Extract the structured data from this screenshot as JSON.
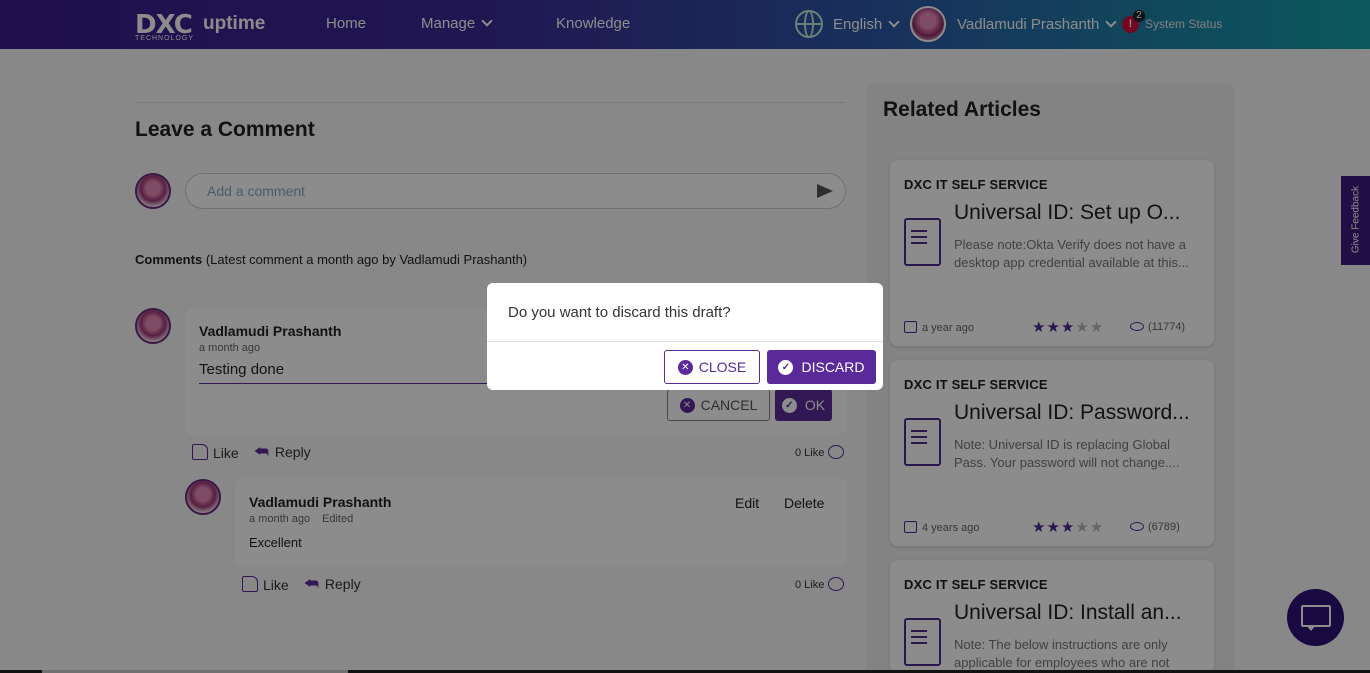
{
  "header": {
    "logo_dxc": "DXC",
    "logo_sub": "TECHNOLOGY",
    "logo_app": "uptime",
    "nav": {
      "home": "Home",
      "manage": "Manage",
      "knowledge": "Knowledge"
    },
    "language": "English",
    "user_name": "Vadlamudi Prashanth",
    "alert_count": "2",
    "system_status": "System Status"
  },
  "comment_section": {
    "title": "Leave a Comment",
    "input_placeholder": "Add a comment",
    "comments_label": "Comments",
    "comments_meta": "(Latest comment a month ago by Vadlamudi Prashanth)"
  },
  "comments": [
    {
      "author": "Vadlamudi Prashanth",
      "time": "a month ago",
      "edit_value": "Testing done",
      "cancel_label": "CANCEL",
      "ok_label": "OK",
      "like_label": "Like",
      "reply_label": "Reply",
      "like_count": "0 Like"
    },
    {
      "author": "Vadlamudi Prashanth",
      "time": "a month ago",
      "edited": "Edited",
      "text": "Excellent",
      "edit_label": "Edit",
      "delete_label": "Delete",
      "like_label": "Like",
      "reply_label": "Reply",
      "like_count": "0 Like"
    }
  ],
  "related": {
    "title": "Related Articles",
    "articles": [
      {
        "source": "DXC IT SELF SERVICE",
        "title": "Universal ID: Set up O...",
        "desc": "Please note:Okta Verify does not have a desktop app credential available at this...",
        "date": "a year ago",
        "rating": 3,
        "views": "(11774)"
      },
      {
        "source": "DXC IT SELF SERVICE",
        "title": "Universal ID: Password...",
        "desc": "Note: Universal ID is replacing Global Pass. Your password will not change....",
        "date": "4 years ago",
        "rating": 3,
        "views": "(6789)"
      },
      {
        "source": "DXC IT SELF SERVICE",
        "title": "Universal ID: Install an...",
        "desc": "Note: The below instructions are only applicable for employees who are not ab..."
      }
    ]
  },
  "feedback_label": "Give Feedback",
  "dialog": {
    "message": "Do you want to discard this draft?",
    "close_label": "CLOSE",
    "discard_label": "DISCARD"
  },
  "colors": {
    "accent": "#5a2a9a",
    "header_start": "#3a1d8c",
    "header_end": "#14a3a8"
  }
}
